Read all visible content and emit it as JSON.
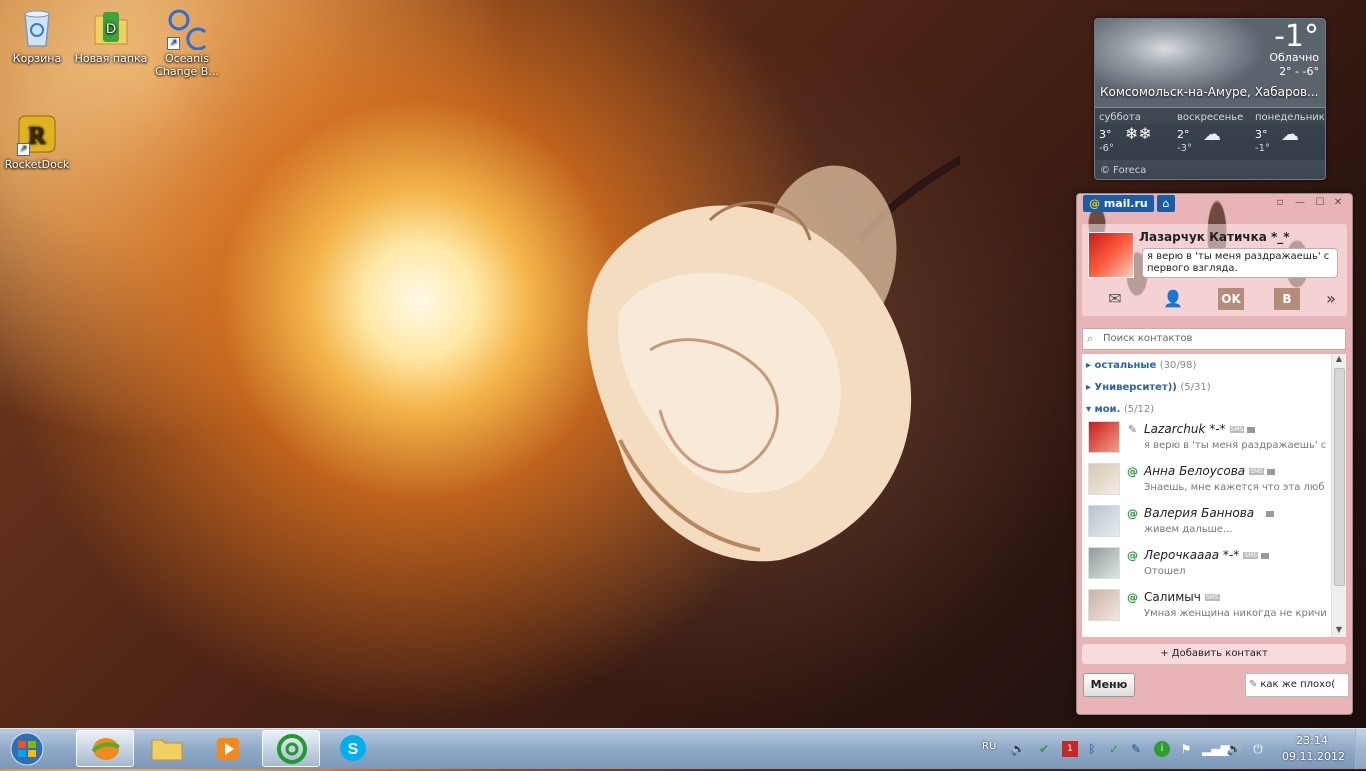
{
  "desktop": {
    "icons": [
      {
        "label": "Корзина"
      },
      {
        "label": "Новая папка"
      },
      {
        "label_line1": "Oceanis",
        "label_line2": "Change B..."
      },
      {
        "label": "RocketDock"
      }
    ]
  },
  "weather": {
    "temp": "-1°",
    "condition": "Облачно",
    "range": "2° - -6°",
    "city": "Комсомольск-на-Амуре, Хабаров...",
    "forecast": [
      {
        "day": "суббота",
        "hi": "3°",
        "lo": "-6°"
      },
      {
        "day": "воскресенье",
        "hi": "2°",
        "lo": "-3°"
      },
      {
        "day": "понедельник",
        "hi": "3°",
        "lo": "-1°"
      }
    ],
    "credit": "© Foreca"
  },
  "agent": {
    "logo_text": "mail.ru",
    "logo_at": "@",
    "profile": {
      "name": "Лазарчук Катичка *_*",
      "status": "я верю в 'ты меня раздражаешь' с первого взгляда."
    },
    "search_placeholder": "Поиск контактов",
    "groups": [
      {
        "name": "остальные",
        "count": "(30/98)"
      },
      {
        "name": "Университет))",
        "count": "(5/31)"
      },
      {
        "name": "мои.",
        "count": "(5/12)"
      }
    ],
    "contacts": [
      {
        "name": "Lazarchuk *-*",
        "status": "я верю в 'ты меня раздражаешь' с"
      },
      {
        "name": "Анна Белоусова",
        "status": "Знаешь, мне кажется что эта люб"
      },
      {
        "name": "Валерия Баннова",
        "status": "живем дальше..."
      },
      {
        "name": "Лерочкаааа *-*",
        "status": "Отошел"
      },
      {
        "name": "Салимыч",
        "status": "Умная женщина никогда не кричи"
      }
    ],
    "sms_label": "SMS",
    "add_contact": "+ Добавить контакт",
    "menu_label": "Меню",
    "my_status": "как же плохо("
  },
  "taskbar": {
    "lang": "RU",
    "time": "23:14",
    "date": "09.11.2012"
  },
  "colors": {
    "accent": "#1b5ca7",
    "online": "#1f9a2c",
    "group_text": "#2a63a8"
  }
}
